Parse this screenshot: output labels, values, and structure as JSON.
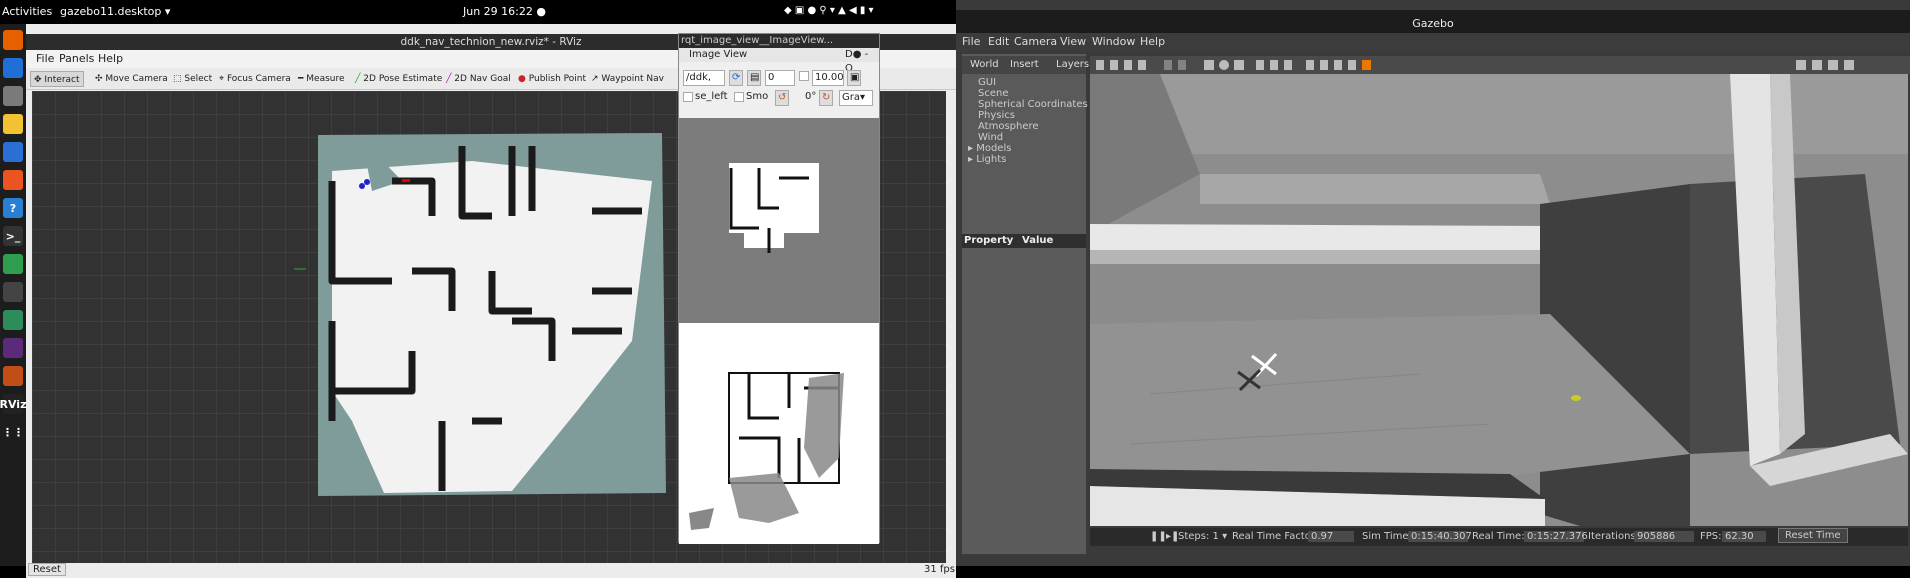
{
  "topbar": {
    "activities": "Activities",
    "app": "gazebo11.desktop ▾",
    "clock": "Jun 29  16:22  ●",
    "tray": "◆ ▣ ● ⚲ ▾ ▲ ◀ ▮ ▾"
  },
  "dock": [
    "firefox-icon",
    "thunderbird-icon",
    "files-icon",
    "rhythmbox-icon",
    "writer-icon",
    "software-icon",
    "help-icon",
    "terminal-icon",
    "spreadsheet-icon",
    "ros-icon",
    "chrome-icon",
    "slack-icon",
    "stack-icon",
    "rviz-icon",
    "apps-grid-icon"
  ],
  "dock_labels": [
    "",
    "",
    "",
    "",
    "",
    "",
    "?",
    ">_",
    "",
    "",
    "",
    "",
    "",
    "RViz",
    "⋮⋮"
  ],
  "rviz": {
    "title": "ddk_nav_technion_new.rviz* - RViz",
    "menu": [
      "File",
      "Panels",
      "Help"
    ],
    "tools": [
      "Interact",
      "Move Camera",
      "Select",
      "Focus Camera",
      "Measure",
      "2D Pose Estimate",
      "2D Nav Goal",
      "Publish Point",
      "Waypoint Nav"
    ],
    "reset": "Reset",
    "fps": "31 fps"
  },
  "rqt": {
    "title": "rqt_image_view__ImageView...",
    "header": "Image View",
    "header_buttons": "D● - O",
    "topic": "/ddk,",
    "spin_value": "0",
    "zoom": "10.00",
    "checkbox1": "se_left",
    "checkbox2": "Smo",
    "rotation": "0°",
    "color_mode": "Gra▾"
  },
  "gazebo": {
    "title": "Gazebo",
    "menu": [
      "File",
      "Edit",
      "Camera",
      "View",
      "Window",
      "Help"
    ],
    "tabs": [
      "World",
      "Insert",
      "Layers"
    ],
    "tree": [
      "GUI",
      "Scene",
      "Spherical Coordinates",
      "Physics",
      "Atmosphere",
      "Wind",
      "Models",
      "Lights"
    ],
    "prop_headers": [
      "Property",
      "Value"
    ],
    "bottom": {
      "steps_label": "Steps: 1 ▾",
      "rtf_label": "Real Time Factor:",
      "rtf": "0.97",
      "sim_label": "Sim Time:",
      "sim": "0:15:40.307",
      "real_label": "Real Time:",
      "real": "0:15:27.376",
      "iter_label": "Iterations:",
      "iter": "905886",
      "fps_label": "FPS:",
      "fps": "62.30",
      "reset": "Reset Time"
    }
  }
}
